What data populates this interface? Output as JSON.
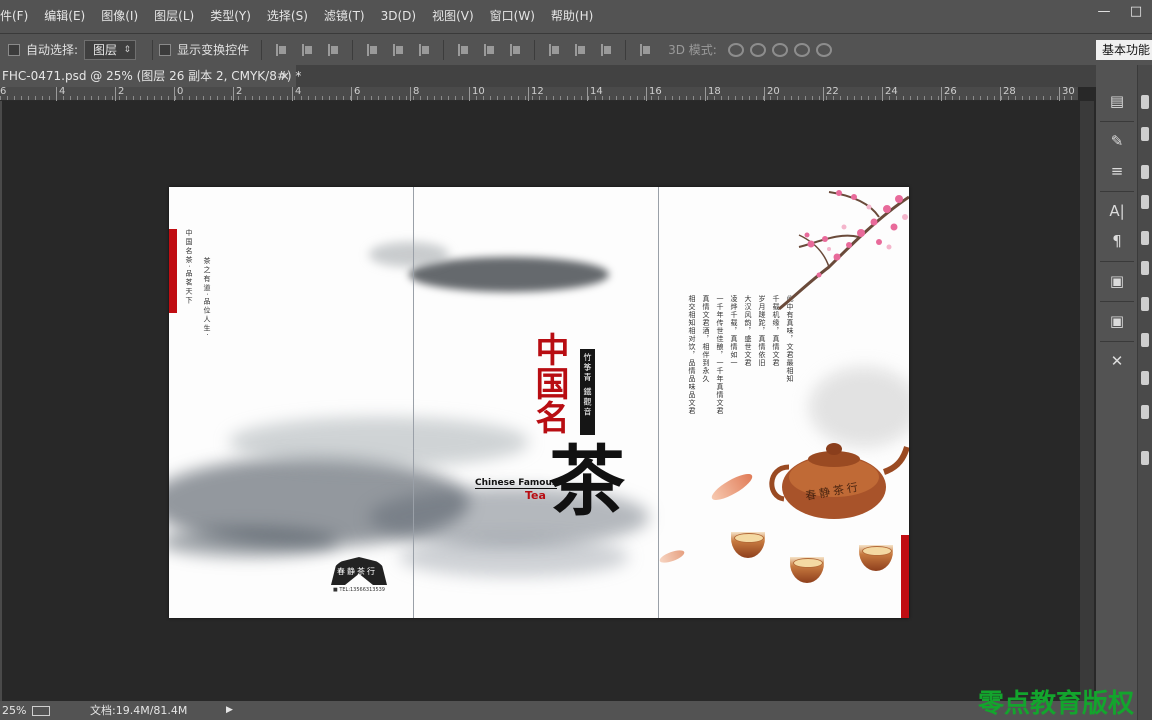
{
  "menu": {
    "items": [
      "件(F)",
      "编辑(E)",
      "图像(I)",
      "图层(L)",
      "类型(Y)",
      "选择(S)",
      "滤镜(T)",
      "3D(D)",
      "视图(V)",
      "窗口(W)",
      "帮助(H)"
    ],
    "minimize": "—",
    "restore": "□"
  },
  "options": {
    "auto_select_label": "自动选择:",
    "auto_select_value": "图层",
    "show_transform_label": "显示变换控件",
    "mode_3d_label": "3D 模式:",
    "workspace_label": "基本功能"
  },
  "tab": {
    "title": "FHC-0471.psd @ 25% (图层 26 副本 2, CMYK/8#) *",
    "close": "×"
  },
  "ruler": {
    "labels": [
      "6",
      "4",
      "2",
      "0",
      "2",
      "4",
      "6",
      "8",
      "10",
      "12",
      "14",
      "16",
      "18",
      "20",
      "22",
      "24",
      "26",
      "28",
      "30"
    ]
  },
  "document": {
    "left_vertical_1": "中国名茶·品茗天下",
    "left_vertical_2": "茶之有道·品位人生·",
    "title_chars": "中国名",
    "tea_char": "茶",
    "seal_1": "竹筝青",
    "seal_2": "鐵觀音",
    "english_1": "Chinese Famous",
    "english_2": "Tea",
    "fan_text": "春静茶行",
    "phone": "■ TEL:13566313539",
    "poem_columns": [
      "此中有真味，文君最相知",
      "千载机缘，真情文君",
      "岁月蹉跎，真情依旧",
      "大汉风韵，盛世文君",
      "凌烨千载，真情如一",
      "一千年传世佳酿，一千年真情文君",
      "真情文君酒，相伴到永久",
      "相交相知相对饮，品情品味品文君"
    ],
    "teapot_text": "春静茶行"
  },
  "status": {
    "zoom": "25%",
    "doc_info": "文档:19.4M/81.4M",
    "arrow": "▶"
  },
  "watermark": "零点教育版权"
}
